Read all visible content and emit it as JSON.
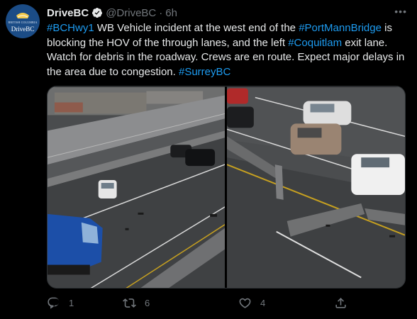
{
  "account": {
    "display_name": "DriveBC",
    "handle": "@DriveBC",
    "separator": "·",
    "time": "6h",
    "avatar_text_small": "BRITISH COLUMBIA",
    "avatar_text": "DriveBC",
    "verified_icon": "verified-badge-icon"
  },
  "tweet": {
    "parts": [
      {
        "text": "#BCHwy1",
        "tag": true
      },
      {
        "text": " WB Vehicle incident at the west end of the ",
        "tag": false
      },
      {
        "text": "#PortMannBridge",
        "tag": true
      },
      {
        "text": " is blocking the HOV of the through lanes, and the left ",
        "tag": false
      },
      {
        "text": "#Coquitlam",
        "tag": true
      },
      {
        "text": " exit lane. Watch for debris in the roadway. Crews are en route. Expect major delays in the area due to congestion. ",
        "tag": false
      },
      {
        "text": "#SurreyBC",
        "tag": true
      }
    ]
  },
  "media": {
    "images": [
      "highway-camera-left",
      "highway-camera-right"
    ]
  },
  "actions": {
    "reply_count": "1",
    "retweet_count": "6",
    "like_count": "4",
    "share_count": ""
  },
  "colors": {
    "background": "#000000",
    "text": "#e7e9ea",
    "muted": "#71767b",
    "link": "#1d9bf0"
  }
}
